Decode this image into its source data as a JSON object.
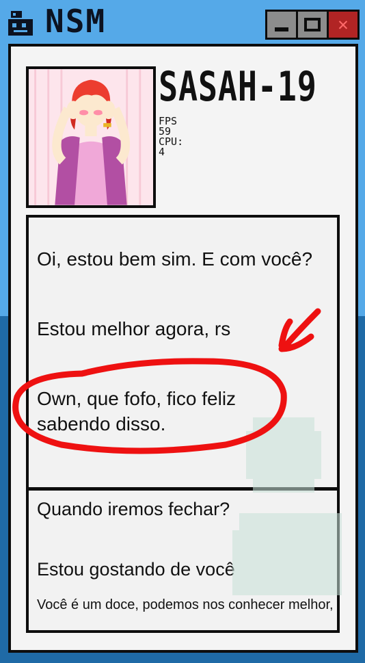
{
  "window": {
    "title": "NSM",
    "icon": "robot-icon",
    "buttons": {
      "minimize": "minimize-icon",
      "maximize": "maximize-icon",
      "close": "close-icon"
    }
  },
  "character": {
    "name": "SASAH-19",
    "avatar": "anime-girl-avatar",
    "fps_label": "FPS",
    "fps_value": "59",
    "cpu_label": "CPU:",
    "cpu_value": "4"
  },
  "chat": {
    "messages": [
      "Oi, estou bem sim. E com você?",
      "Estou melhor agora, rs",
      "Own, que fofo, fico feliz sabendo disso."
    ]
  },
  "options": [
    "Quando iremos fechar?",
    "Estou gostando de você",
    "Você é um doce, podemos nos conhecer melhor, rs"
  ],
  "colors": {
    "sky": "#55a9e8",
    "sea": "#1f6aa6",
    "annotation": "#ee1111"
  }
}
